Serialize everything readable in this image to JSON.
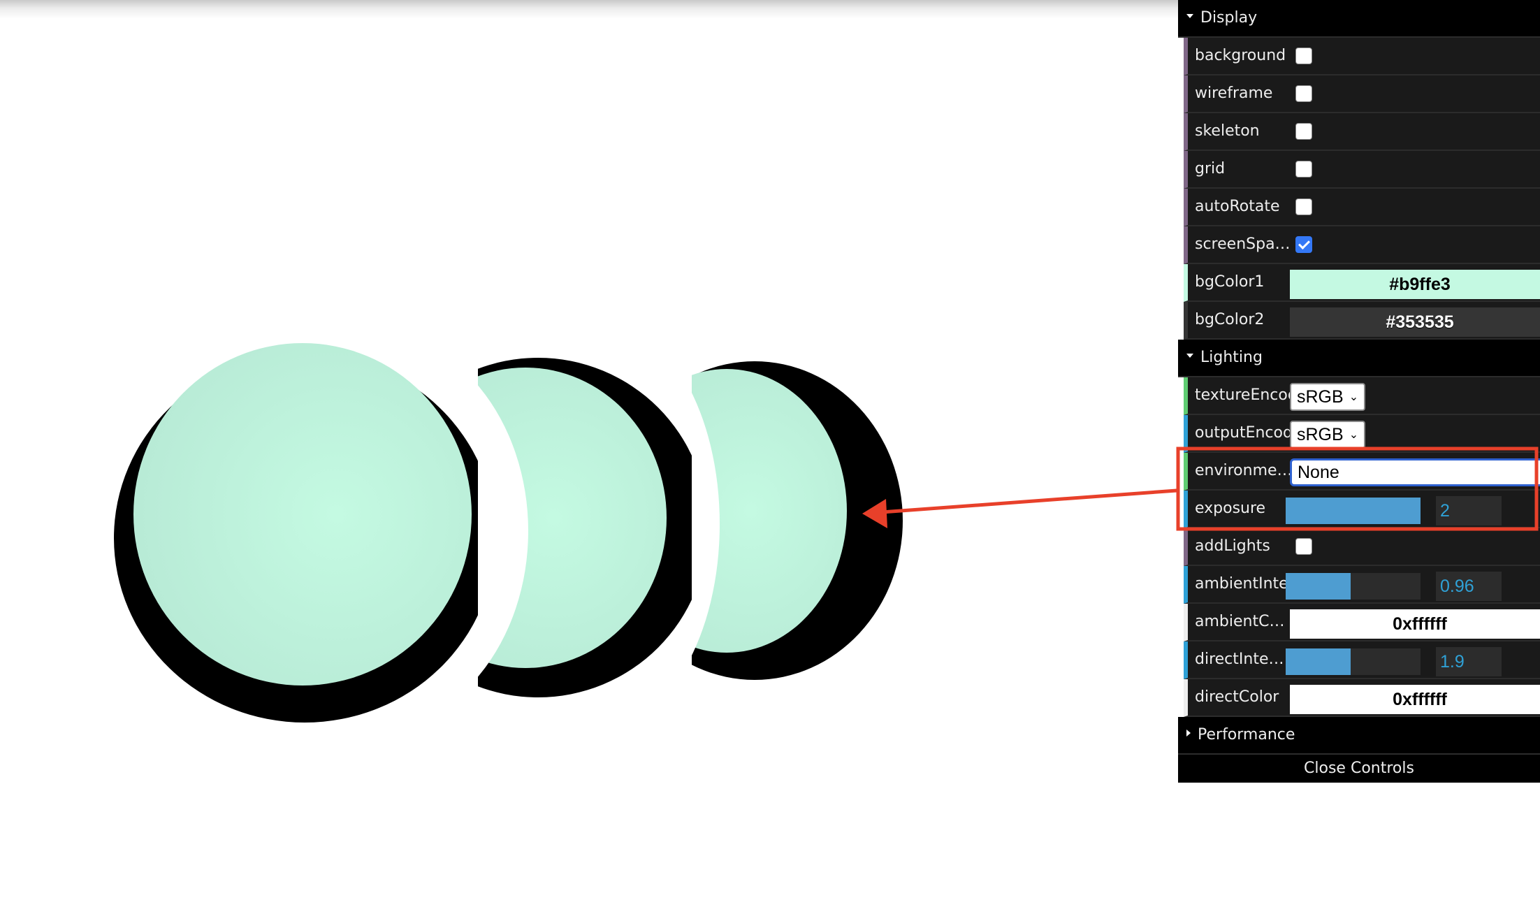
{
  "viewport": {
    "scene_description": "Three mint-colored spheres with black toon outlines, progressively lit from the right",
    "sphere_color": "#b9ffe3",
    "outline_color": "#000000"
  },
  "annotation": {
    "box_color": "#e8402a",
    "arrow_color": "#e8402a",
    "highlighted_controls": [
      "environment",
      "exposure"
    ]
  },
  "gui": {
    "folders": [
      {
        "title": "Display",
        "open": true,
        "controls": [
          {
            "label": "background",
            "type": "checkbox",
            "checked": false
          },
          {
            "label": "wireframe",
            "type": "checkbox",
            "checked": false
          },
          {
            "label": "skeleton",
            "type": "checkbox",
            "checked": false
          },
          {
            "label": "grid",
            "type": "checkbox",
            "checked": false
          },
          {
            "label": "autoRotate",
            "type": "checkbox",
            "checked": false
          },
          {
            "label": "screenSpacePan…",
            "type": "checkbox",
            "checked": true
          },
          {
            "label": "bgColor1",
            "type": "color",
            "value": "#b9ffe3",
            "swatch": "#c4f9e2",
            "text_color": "#000000"
          },
          {
            "label": "bgColor2",
            "type": "color",
            "value": "#353535",
            "swatch": "#353535",
            "text_color": "#ffffff"
          }
        ]
      },
      {
        "title": "Lighting",
        "open": true,
        "controls": [
          {
            "label": "textureEncoding",
            "type": "select",
            "value": "sRGB"
          },
          {
            "label": "outputEncoding",
            "type": "select",
            "value": "sRGB"
          },
          {
            "label": "environment",
            "type": "select",
            "value": "None"
          },
          {
            "label": "exposure",
            "type": "slider",
            "value": "2",
            "fill_fraction": 1.0
          },
          {
            "label": "addLights",
            "type": "checkbox",
            "checked": false
          },
          {
            "label": "ambientIntensity",
            "type": "slider",
            "value": "0.96",
            "fill_fraction": 0.48
          },
          {
            "label": "ambientColor",
            "type": "color",
            "value": "0xffffff",
            "swatch": "#ffffff",
            "text_color": "#000000"
          },
          {
            "label": "directIntensity",
            "type": "slider",
            "value": "1.9",
            "fill_fraction": 0.48
          },
          {
            "label": "directColor",
            "type": "color",
            "value": "0xffffff",
            "swatch": "#ffffff",
            "text_color": "#000000"
          }
        ]
      },
      {
        "title": "Performance",
        "open": false,
        "controls": []
      }
    ],
    "close_label": "Close Controls"
  }
}
